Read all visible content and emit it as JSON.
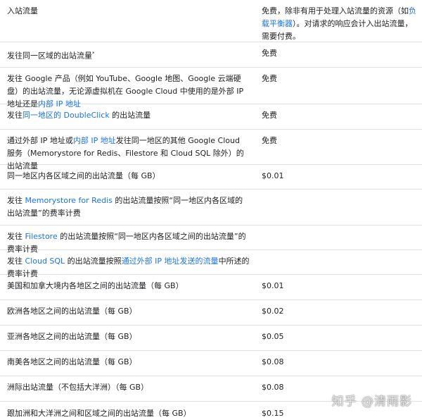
{
  "rows": [
    {
      "col1_parts": [
        {
          "t": "入站流量"
        }
      ],
      "col2_parts": [
        {
          "t": "免费，除非有用于处理入站流量的资源（如"
        },
        {
          "t": "负载平衡器",
          "link": true
        },
        {
          "t": "）。对请求的响应会计入出站流量，需要付费。"
        }
      ]
    },
    {
      "col1_parts": [
        {
          "t": "发往同一区域的出站流量"
        },
        {
          "t": "*",
          "sup": true
        }
      ],
      "col2_parts": [
        {
          "t": "免费"
        }
      ]
    },
    {
      "col1_parts": [
        {
          "t": "发往 Google 产品（例如 YouTube、Google 地图、Google 云端硬盘）的出站流量，无论源虚拟机在 Google Cloud 中使用的是外部 IP 地址还是"
        },
        {
          "t": "内部 IP 地址",
          "link": true
        }
      ],
      "col2_parts": [
        {
          "t": "免费"
        }
      ]
    },
    {
      "col1_parts": [
        {
          "t": "发往"
        },
        {
          "t": "同一地区的 DoubleClick",
          "link": true
        },
        {
          "t": " 的出站流量"
        }
      ],
      "col2_parts": [
        {
          "t": "免费"
        }
      ]
    },
    {
      "col1_parts": [
        {
          "t": "通过外部 IP 地址或"
        },
        {
          "t": "内部 IP 地址",
          "link": true
        },
        {
          "t": "发往同一地区的其他 Google Cloud 服务（Memorystore for Redis、Filestore 和 Cloud SQL 除外）的出站流量"
        }
      ],
      "col2_parts": [
        {
          "t": "免费"
        }
      ]
    },
    {
      "col1_parts": [
        {
          "t": "同一地区内各区域之间的出站流量（每 GB）"
        }
      ],
      "col2_parts": [
        {
          "t": "$0.01"
        }
      ]
    },
    {
      "col1_parts": [
        {
          "t": "发往 "
        },
        {
          "t": "Memorystore for Redis",
          "link": true
        },
        {
          "t": " 的出站流量按照“同一地区内各区域的出站流量”的费率计费"
        }
      ],
      "col2_parts": []
    },
    {
      "col1_parts": [
        {
          "t": "发往 "
        },
        {
          "t": "Filestore",
          "link": true
        },
        {
          "t": " 的出站流量按照“同一地区内各区域之间的出站流量”的费率计费"
        }
      ],
      "col2_parts": []
    },
    {
      "col1_parts": [
        {
          "t": "发往 "
        },
        {
          "t": "Cloud SQL",
          "link": true
        },
        {
          "t": " 的出站流量按照"
        },
        {
          "t": "通过外部 IP 地址发送的流量",
          "link": true
        },
        {
          "t": "中所述的费率计费"
        }
      ],
      "col2_parts": []
    },
    {
      "col1_parts": [
        {
          "t": "美国和加拿大境内各地区之间的出站流量（每 GB）"
        }
      ],
      "col2_parts": [
        {
          "t": "$0.01"
        }
      ]
    },
    {
      "col1_parts": [
        {
          "t": "欧洲各地区之间的出站流量（每 GB）"
        }
      ],
      "col2_parts": [
        {
          "t": "$0.02"
        }
      ]
    },
    {
      "col1_parts": [
        {
          "t": "亚洲各地区之间的出站流量（每 GB）"
        }
      ],
      "col2_parts": [
        {
          "t": "$0.05"
        }
      ]
    },
    {
      "col1_parts": [
        {
          "t": "南美各地区之间的出站流量（每 GB）"
        }
      ],
      "col2_parts": [
        {
          "t": "$0.08"
        }
      ]
    },
    {
      "col1_parts": [
        {
          "t": "洲际出站流量（不包括大洋洲）（每 GB）"
        }
      ],
      "col2_parts": [
        {
          "t": "$0.08"
        }
      ]
    }
  ],
  "partial_row": {
    "col1": "跟加洲和大洋洲之间和区域之间的出站流量（每 GB）",
    "col2": "$0.15"
  },
  "watermark": "知乎 @清雨影",
  "colors": {
    "link": "#1a73e8",
    "text": "#202124",
    "border": "#e0e0e0"
  }
}
